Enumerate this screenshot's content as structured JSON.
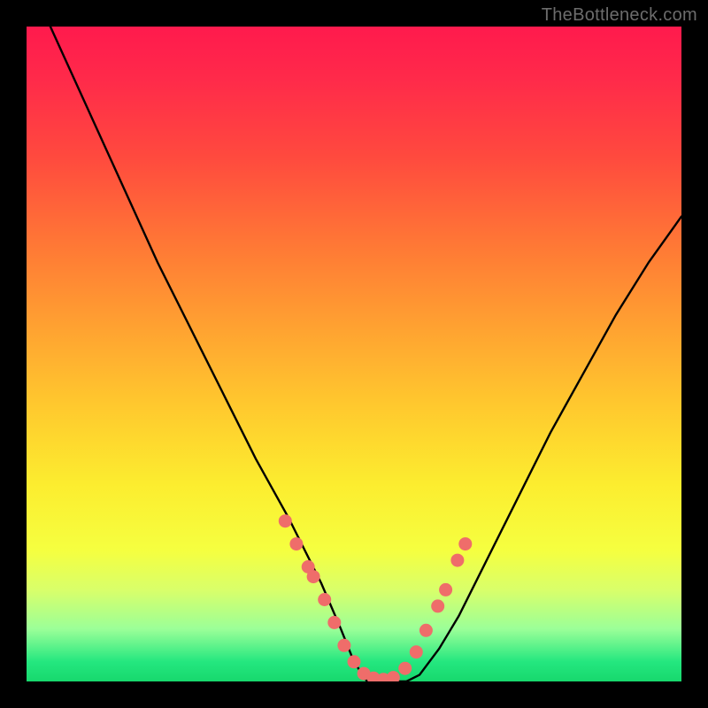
{
  "watermark": "TheBottleneck.com",
  "chart_data": {
    "type": "line",
    "title": "",
    "xlabel": "",
    "ylabel": "",
    "xlim": [
      0,
      100
    ],
    "ylim": [
      0,
      100
    ],
    "series": [
      {
        "name": "main-curve",
        "x": [
          0,
          5,
          10,
          15,
          20,
          25,
          30,
          35,
          40,
          45,
          48,
          50,
          52,
          55,
          58,
          60,
          63,
          66,
          70,
          75,
          80,
          85,
          90,
          95,
          100
        ],
        "y": [
          108,
          97,
          86,
          75,
          64,
          54,
          44,
          34,
          25,
          15,
          8,
          3,
          0,
          0,
          0,
          1,
          5,
          10,
          18,
          28,
          38,
          47,
          56,
          64,
          71
        ]
      }
    ],
    "markers": {
      "name": "highlight-dots",
      "x": [
        39.5,
        41.2,
        43.0,
        43.8,
        45.5,
        47.0,
        48.5,
        50.0,
        51.5,
        53.0,
        54.5,
        56.0,
        57.8,
        59.5,
        61.0,
        62.8,
        64.0,
        65.8,
        67.0
      ],
      "y": [
        24.5,
        21.0,
        17.5,
        16.0,
        12.5,
        9.0,
        5.5,
        3.0,
        1.2,
        0.5,
        0.3,
        0.6,
        2.0,
        4.5,
        7.8,
        11.5,
        14.0,
        18.5,
        21.0
      ],
      "color": "#ef6d6a",
      "radius_px": 7.5
    },
    "background_gradient": [
      "#ff1a4d",
      "#ffa231",
      "#fced2f",
      "#17d86d"
    ]
  }
}
